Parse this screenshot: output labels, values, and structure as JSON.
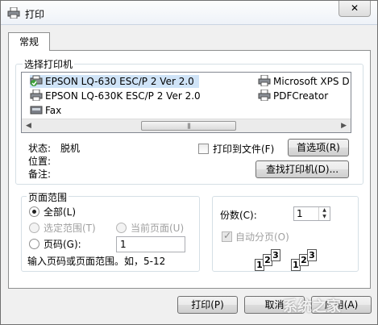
{
  "window": {
    "title": "打印",
    "close_glyph": "✕"
  },
  "tabs": [
    {
      "label": "常规"
    }
  ],
  "printer_group": {
    "legend": "选择打印机",
    "printers": [
      {
        "name": "EPSON LQ-630 ESC/P 2 Ver 2.0",
        "default": true,
        "selected": true
      },
      {
        "name": "Microsoft XPS D"
      },
      {
        "name": "EPSON LQ-630K ESC/P 2 Ver 2.0"
      },
      {
        "name": "PDFCreator"
      },
      {
        "name": "Fax"
      }
    ],
    "scroll_thumb": "|||"
  },
  "status": {
    "status_label": "状态:",
    "status_value": "脱机",
    "location_label": "位置:",
    "location_value": "",
    "comment_label": "备注:",
    "comment_value": ""
  },
  "print_to_file": {
    "label": "打印到文件(F)",
    "checked": false
  },
  "buttons": {
    "preferences": "首选项(R)",
    "find_printer": "查找打印机(D)...",
    "print": "打印(P)",
    "cancel": "取消",
    "apply": "应用(A)"
  },
  "page_range": {
    "legend": "页面范围",
    "all": "全部(L)",
    "selection": "选定范围(T)",
    "current_page": "当前页面(U)",
    "pages": "页码(G):",
    "pages_value": "1",
    "hint": "输入页码或页面范围。如，5-12"
  },
  "copies": {
    "label": "份数(C):",
    "value": "1",
    "collate": "自动分页(O)",
    "collate_checked": true,
    "collate_digits": [
      "1",
      "2",
      "3"
    ]
  },
  "watermark": "系统之家"
}
